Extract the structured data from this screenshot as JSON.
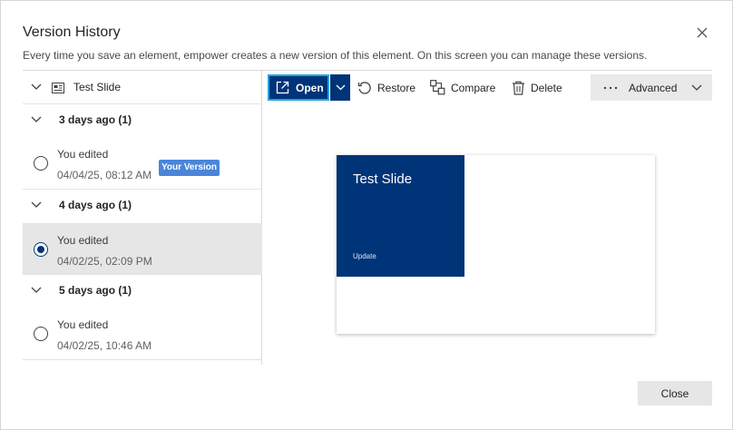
{
  "dialog": {
    "title": "Version History",
    "subtitle": "Every time you save an element, empower creates a new version of this element. On this screen you can manage these versions.",
    "close_icon": "close-icon"
  },
  "tree": {
    "root_label": "Test Slide",
    "groups": [
      {
        "label": "3 days ago (1)",
        "items": [
          {
            "author": "You edited",
            "date": "04/04/25, 08:12 AM",
            "badge": "Your Version",
            "selected": false
          }
        ]
      },
      {
        "label": "4 days ago (1)",
        "items": [
          {
            "author": "You edited",
            "date": "04/02/25, 02:09 PM",
            "selected": true
          }
        ]
      },
      {
        "label": "5 days ago (1)",
        "items": [
          {
            "author": "You edited",
            "date": "04/02/25, 10:46 AM",
            "selected": false
          }
        ]
      }
    ]
  },
  "toolbar": {
    "open_label": "Open",
    "restore_label": "Restore",
    "compare_label": "Compare",
    "delete_label": "Delete",
    "advanced_label": "Advanced"
  },
  "preview": {
    "title": "Test Slide",
    "subtitle": "Update"
  },
  "footer": {
    "close_label": "Close"
  },
  "colors": {
    "brand": "#003478",
    "focus_ring": "#22a3e0",
    "badge": "#4a86d8"
  }
}
